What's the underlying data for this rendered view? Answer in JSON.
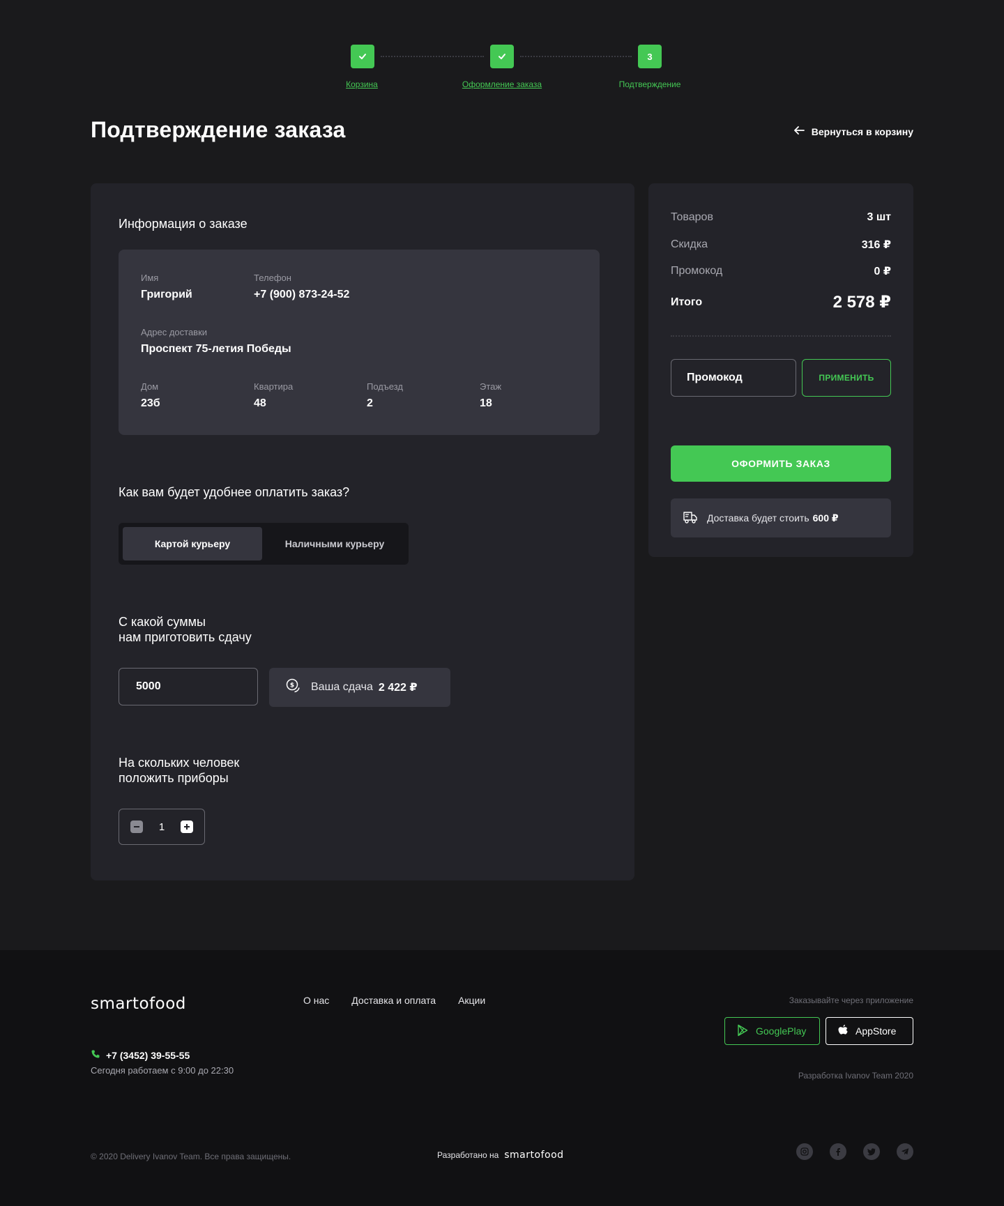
{
  "stepper": {
    "steps": [
      {
        "label": "Корзина",
        "status": "done"
      },
      {
        "label": "Оформление заказа",
        "status": "done"
      },
      {
        "label": "Подтверждение",
        "status": "current",
        "number": "3"
      }
    ]
  },
  "header": {
    "title": "Подтверждение заказа",
    "back_link": "Вернуться в корзину"
  },
  "order_info": {
    "title": "Информация о заказе",
    "name_label": "Имя",
    "name_value": "Григорий",
    "phone_label": "Телефон",
    "phone_value": "+7 (900) 873-24-52",
    "address_label": "Адрес доставки",
    "address_value": "Проспект 75-летия Победы",
    "house_label": "Дом",
    "house_value": "23б",
    "apartment_label": "Квартира",
    "apartment_value": "48",
    "entrance_label": "Подъезд",
    "entrance_value": "2",
    "floor_label": "Этаж",
    "floor_value": "18"
  },
  "payment": {
    "question": "Как вам будет удобнее оплатить заказ?",
    "options": [
      "Картой курьеру",
      "Наличными курьеру"
    ],
    "selected": "Картой курьеру"
  },
  "change": {
    "title_line1": "С какой суммы",
    "title_line2": "нам приготовить сдачу",
    "input_value": "5000",
    "change_label": "Ваша сдача",
    "change_amount": "2 422 ₽"
  },
  "cutlery": {
    "title_line1": "На скольких человек",
    "title_line2": "положить приборы",
    "count": "1"
  },
  "summary": {
    "items_label": "Товаров",
    "items_value": "3 шт",
    "discount_label": "Скидка",
    "discount_value": "316 ₽",
    "promo_label": "Промокод",
    "promo_value": "0 ₽",
    "total_label": "Итого",
    "total_value": "2 578 ₽",
    "promo_placeholder": "Промокод",
    "apply_button": "ПРИМЕНИТЬ",
    "order_button": "ОФОРМИТЬ ЗАКАЗ",
    "delivery_label": "Доставка будет стоить",
    "delivery_cost": "600 ₽"
  },
  "footer": {
    "logo": "smartofood",
    "nav": [
      "О нас",
      "Доставка и оплата",
      "Акции"
    ],
    "phone": "+7 (3452) 39-55-55",
    "hours": "Сегодня работаем с 9:00 до 22:30",
    "app_title": "Заказывайте через приложение",
    "google_play": "GooglePlay",
    "app_store": "AppStore",
    "dev_credit": "Разработка Ivanov Team 2020",
    "copyright": "© 2020 Delivery Ivanov Team. Все права защищены.",
    "made_on_label": "Разработано на",
    "made_on_logo": "smartofood",
    "socials": [
      "instagram-icon",
      "facebook-icon",
      "twitter-icon",
      "telegram-icon"
    ]
  },
  "colors": {
    "accent": "#44c854",
    "background": "#1a1a1c",
    "panel": "#232329",
    "card": "#35353e",
    "footer": "#111113"
  }
}
